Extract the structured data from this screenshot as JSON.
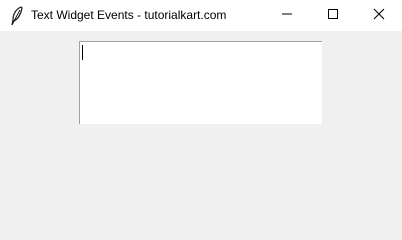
{
  "window": {
    "title": "Text Widget Events - tutorialkart.com",
    "app_icon": "feather-icon",
    "controls": {
      "minimize_icon": "minimize-icon",
      "maximize_icon": "maximize-icon",
      "close_icon": "close-icon"
    }
  },
  "text_widget": {
    "value": ""
  },
  "colors": {
    "titlebar": "#ffffff",
    "client_background": "#f0f0f0",
    "text_background": "#ffffff",
    "border": "#a0a0a0"
  }
}
